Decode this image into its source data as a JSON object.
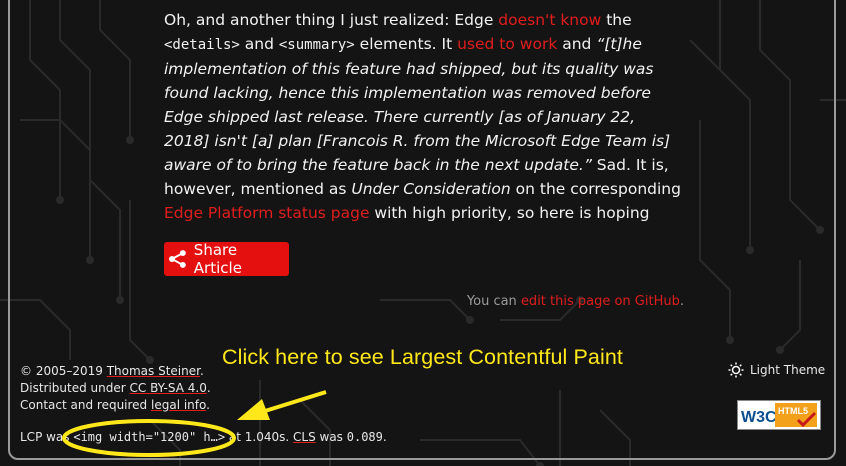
{
  "article": {
    "p1": "Oh, and another thing I just realized: Edge ",
    "link_doesnt_know": "doesn't know",
    "p2": " the",
    "code_details": "<details>",
    "p3": " and ",
    "code_summary": "<summary>",
    "p4": " elements. It ",
    "link_used_to_work": "used to work",
    "p5": " and ",
    "quote": "“[t]he implementation of this feature had shipped, but its quality was found lacking, hence this implementation was removed before Edge shipped last release. There currently [as of January 22, 2018] isn't [a] plan [Francois R. from the Microsoft Edge Team is] aware of to bring the feature back in the next update.”",
    "p6": " Sad. It is, however, mentioned as ",
    "under_consideration": "Under Consideration",
    "p7": " on the corresponding ",
    "link_status_page": "Edge Platform status page",
    "p8": " with high priority, so here is hoping"
  },
  "share": {
    "label": "Share Article",
    "icon": "share-icon"
  },
  "edit": {
    "prefix": "You can ",
    "link": "edit this page on GitHub",
    "suffix": "."
  },
  "footer": {
    "copyright_prefix": "© 2005–2019 ",
    "author": "Thomas Steiner",
    "copyright_suffix": ".",
    "license_prefix": "Distributed under ",
    "license": "CC BY-SA 4.0",
    "license_suffix": ".",
    "contact_prefix": "Contact and required ",
    "legal": "legal info",
    "contact_suffix": ".",
    "lcp_prefix": "LCP was ",
    "lcp_element": "<img width=\"1200\" h…>",
    "lcp_mid": " at 1.040s. ",
    "cls_label": "CLS",
    "cls_mid": " was ",
    "cls_value": "0.089",
    "cls_suffix": "."
  },
  "theme": {
    "label": "Light Theme",
    "icon": "sun-icon"
  },
  "badge": {
    "w3c": "W3C",
    "html5": "HTML5"
  },
  "annotation": {
    "text": "Click here to see Largest Contentful Paint"
  },
  "colors": {
    "accent": "#e40f0f",
    "link": "#e01d1d",
    "annotation": "#ffe81a",
    "background": "#141414"
  }
}
